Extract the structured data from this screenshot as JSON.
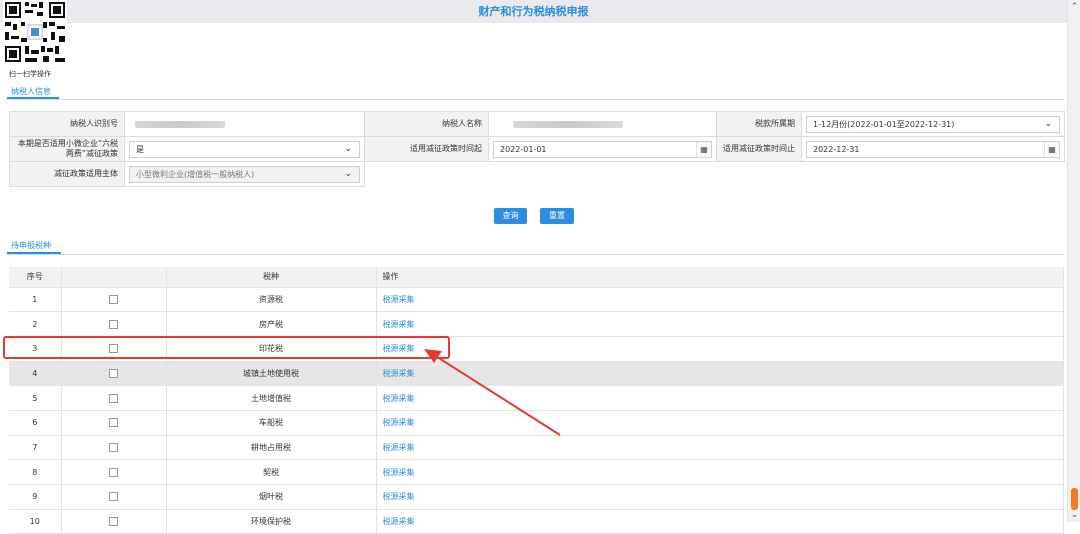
{
  "title": "财产和行为税纳税申报",
  "qr_caption": "扫一扫学操作",
  "taxpayer_tab": "纳税人信息",
  "form": {
    "taxpayer_id_label": "纳税人识别号",
    "taxpayer_name_label": "纳税人名称",
    "tax_period_label": "税款所属期",
    "tax_period_value": "1-12月份(2022-01-01至2022-12-31)",
    "small_micro_label": "本期是否适用小微企业“六税两费”减征政策",
    "small_micro_value": "是",
    "relief_start_label": "适用减征政策时间起",
    "relief_start_value": "2022-01-01",
    "relief_end_label": "适用减征政策时间止",
    "relief_end_value": "2022-12-31",
    "relief_subject_label": "减征政策适用主体",
    "relief_subject_value": "小型微利企业(增值税一般纳税人)"
  },
  "buttons": {
    "query": "查询",
    "reset": "重置"
  },
  "pending_tab": "待申报税种",
  "table": {
    "headers": [
      "序号",
      "",
      "税种",
      "操作"
    ],
    "rows": [
      {
        "no": "1",
        "tax": "资源税",
        "op": "税源采集"
      },
      {
        "no": "2",
        "tax": "房产税",
        "op": "税源采集"
      },
      {
        "no": "3",
        "tax": "印花税",
        "op": "税源采集"
      },
      {
        "no": "4",
        "tax": "城镇土地使用税",
        "op": "税源采集"
      },
      {
        "no": "5",
        "tax": "土地增值税",
        "op": "税源采集"
      },
      {
        "no": "6",
        "tax": "车船税",
        "op": "税源采集"
      },
      {
        "no": "7",
        "tax": "耕地占用税",
        "op": "税源采集"
      },
      {
        "no": "8",
        "tax": "契税",
        "op": "税源采集"
      },
      {
        "no": "9",
        "tax": "烟叶税",
        "op": "税源采集"
      },
      {
        "no": "10",
        "tax": "环境保护税",
        "op": "税源采集"
      }
    ]
  },
  "icons": {
    "chevron": "chevron-down-icon",
    "calendar": "calendar-icon",
    "annotation": "red-arrow-annotation"
  },
  "colors": {
    "accent": "#2b8ee0",
    "annotation": "#e53935",
    "highlight_row": "#e6e6e6"
  }
}
